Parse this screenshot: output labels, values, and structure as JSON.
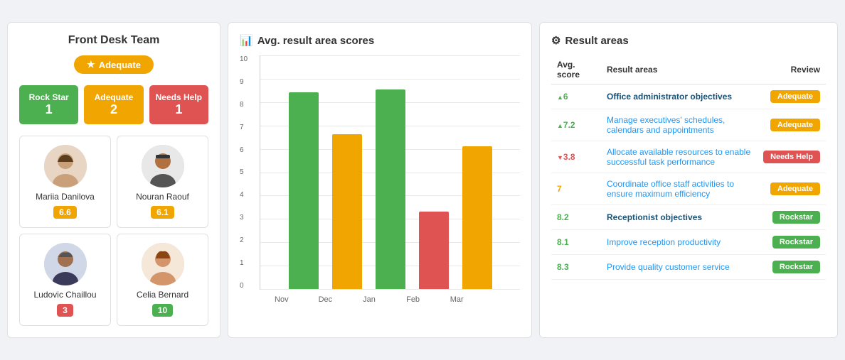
{
  "left": {
    "title": "Front Desk Team",
    "topBadge": "Adequate",
    "stats": [
      {
        "label": "Rock Star",
        "num": "1",
        "color": "green"
      },
      {
        "label": "Adequate",
        "num": "2",
        "color": "orange"
      },
      {
        "label": "Needs Help",
        "num": "1",
        "color": "red"
      }
    ],
    "members": [
      {
        "name": "Mariia Danilova",
        "score": "6.6",
        "scoreColor": "orange",
        "gender": "female"
      },
      {
        "name": "Nouran Raouf",
        "score": "6.1",
        "scoreColor": "orange",
        "gender": "male"
      },
      {
        "name": "Ludovic Chaillou",
        "score": "3",
        "scoreColor": "red",
        "gender": "male2"
      },
      {
        "name": "Celia Bernard",
        "score": "10",
        "scoreColor": "green",
        "gender": "female2"
      }
    ]
  },
  "chart": {
    "title": "Avg. result area scores",
    "yLabels": [
      "0",
      "1",
      "2",
      "3",
      "4",
      "5",
      "6",
      "7",
      "8",
      "9",
      "10"
    ],
    "bars": [
      {
        "month": "Nov",
        "value": 8.4,
        "color": "#4caf50"
      },
      {
        "month": "Dec",
        "value": 6.6,
        "color": "#f0a500"
      },
      {
        "month": "Jan",
        "value": 8.5,
        "color": "#4caf50"
      },
      {
        "month": "Feb",
        "value": 3.3,
        "color": "#e05353"
      },
      {
        "month": "Mar",
        "value": 6.1,
        "color": "#f0a500"
      }
    ],
    "maxValue": 10
  },
  "resultAreas": {
    "title": "Result areas",
    "headers": [
      "Avg. score",
      "Result areas",
      "Review"
    ],
    "rows": [
      {
        "score": "6",
        "scoreClass": "score-up",
        "arrow": "up",
        "area": "Office administrator objectives",
        "areaClass": "area-bold",
        "review": "Adequate",
        "reviewClass": "review-adequate"
      },
      {
        "score": "7.2",
        "scoreClass": "score-up",
        "arrow": "up",
        "area": "Manage executives' schedules, calendars and appointments",
        "areaClass": "area-link",
        "review": "Adequate",
        "reviewClass": "review-adequate"
      },
      {
        "score": "3.8",
        "scoreClass": "score-down",
        "arrow": "down",
        "area": "Allocate available resources to enable successful task performance",
        "areaClass": "area-link",
        "review": "Needs Help",
        "reviewClass": "review-needs-help"
      },
      {
        "score": "7",
        "scoreClass": "score-neutral",
        "arrow": "none",
        "area": "Coordinate office staff activities to ensure maximum efficiency",
        "areaClass": "area-link",
        "review": "Adequate",
        "reviewClass": "review-adequate"
      },
      {
        "score": "8.2",
        "scoreClass": "score-green-bold",
        "arrow": "none",
        "area": "Receptionist objectives",
        "areaClass": "area-bold",
        "review": "Rockstar",
        "reviewClass": "review-rockstar"
      },
      {
        "score": "8.1",
        "scoreClass": "score-green-bold",
        "arrow": "none",
        "area": "Improve reception productivity",
        "areaClass": "area-link",
        "review": "Rockstar",
        "reviewClass": "review-rockstar"
      },
      {
        "score": "8.3",
        "scoreClass": "score-green-bold",
        "arrow": "none",
        "area": "Provide quality customer service",
        "areaClass": "area-link",
        "review": "Rockstar",
        "reviewClass": "review-rockstar"
      }
    ]
  }
}
